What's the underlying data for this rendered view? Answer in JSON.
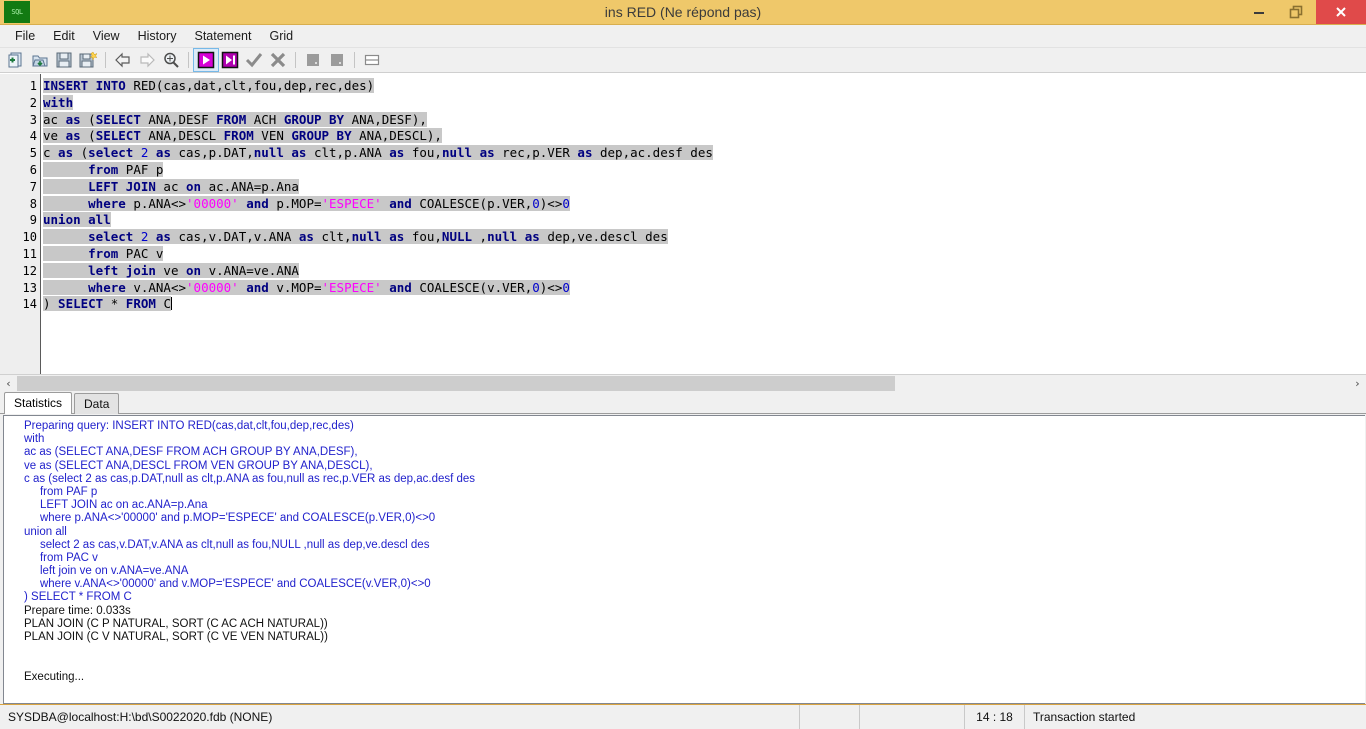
{
  "window": {
    "title": "ins RED (Ne répond pas)",
    "app_icon_text": "SQL",
    "controls": {
      "minimize": "minimize-button",
      "restore": "restore-button",
      "close": "close-button"
    }
  },
  "menubar": {
    "items": [
      {
        "label": "File"
      },
      {
        "label": "Edit"
      },
      {
        "label": "View"
      },
      {
        "label": "History"
      },
      {
        "label": "Statement"
      },
      {
        "label": "Grid"
      }
    ]
  },
  "toolbar": {
    "buttons": [
      {
        "name": "new-query-icon",
        "title": "New"
      },
      {
        "name": "open-file-icon",
        "title": "Open"
      },
      {
        "name": "save-icon",
        "title": "Save"
      },
      {
        "name": "save-as-icon",
        "title": "Save As"
      },
      {
        "name": "history-back-icon",
        "title": "Previous statement"
      },
      {
        "name": "history-forward-icon",
        "title": "Next statement"
      },
      {
        "name": "find-icon",
        "title": "Find"
      },
      {
        "name": "execute-icon",
        "title": "Execute"
      },
      {
        "name": "execute-script-icon",
        "title": "Execute script"
      },
      {
        "name": "commit-icon",
        "title": "Commit"
      },
      {
        "name": "rollback-icon",
        "title": "Rollback"
      },
      {
        "name": "stop-icon",
        "title": "Stop"
      },
      {
        "name": "stop2-icon",
        "title": "Stop all"
      },
      {
        "name": "split-view-icon",
        "title": "Toggle split"
      }
    ]
  },
  "editor": {
    "line_numbers": [
      "1",
      "2",
      "3",
      "4",
      "5",
      "6",
      "7",
      "8",
      "9",
      "10",
      "11",
      "12",
      "13",
      "14"
    ],
    "lines": [
      {
        "n": "1",
        "tokens": [
          {
            "t": "INSERT INTO",
            "c": "kw"
          },
          {
            "t": " RED(cas,dat,clt,fou,dep,rec,des)",
            "c": ""
          }
        ]
      },
      {
        "n": "2",
        "tokens": [
          {
            "t": "with",
            "c": "kw"
          }
        ]
      },
      {
        "n": "3",
        "tokens": [
          {
            "t": "ac",
            "c": ""
          },
          {
            "t": " as ",
            "c": "kw"
          },
          {
            "t": "(",
            "c": ""
          },
          {
            "t": "SELECT",
            "c": "kw"
          },
          {
            "t": " ANA,DESF ",
            "c": ""
          },
          {
            "t": "FROM",
            "c": "kw"
          },
          {
            "t": " ACH ",
            "c": ""
          },
          {
            "t": "GROUP BY",
            "c": "kw"
          },
          {
            "t": " ANA,DESF),",
            "c": ""
          }
        ]
      },
      {
        "n": "4",
        "tokens": [
          {
            "t": "ve",
            "c": ""
          },
          {
            "t": " as ",
            "c": "kw"
          },
          {
            "t": "(",
            "c": ""
          },
          {
            "t": "SELECT",
            "c": "kw"
          },
          {
            "t": " ANA,DESCL ",
            "c": ""
          },
          {
            "t": "FROM",
            "c": "kw"
          },
          {
            "t": " VEN ",
            "c": ""
          },
          {
            "t": "GROUP BY",
            "c": "kw"
          },
          {
            "t": " ANA,DESCL),",
            "c": ""
          }
        ]
      },
      {
        "n": "5",
        "tokens": [
          {
            "t": "c",
            "c": ""
          },
          {
            "t": " as ",
            "c": "kw"
          },
          {
            "t": "(",
            "c": ""
          },
          {
            "t": "select",
            "c": "kw"
          },
          {
            "t": " ",
            "c": ""
          },
          {
            "t": "2",
            "c": "num"
          },
          {
            "t": " as ",
            "c": "kw"
          },
          {
            "t": "cas,p.DAT,",
            "c": ""
          },
          {
            "t": "null",
            "c": "kw"
          },
          {
            "t": " as ",
            "c": "kw"
          },
          {
            "t": "clt,p.ANA",
            "c": ""
          },
          {
            "t": " as ",
            "c": "kw"
          },
          {
            "t": "fou,",
            "c": ""
          },
          {
            "t": "null",
            "c": "kw"
          },
          {
            "t": " as ",
            "c": "kw"
          },
          {
            "t": "rec,p.VER",
            "c": ""
          },
          {
            "t": " as ",
            "c": "kw"
          },
          {
            "t": "dep,ac.desf des",
            "c": ""
          }
        ]
      },
      {
        "n": "6",
        "tokens": [
          {
            "t": "      ",
            "c": ""
          },
          {
            "t": "from",
            "c": "kw"
          },
          {
            "t": " PAF p",
            "c": ""
          }
        ]
      },
      {
        "n": "7",
        "tokens": [
          {
            "t": "      ",
            "c": ""
          },
          {
            "t": "LEFT JOIN",
            "c": "kw"
          },
          {
            "t": " ac ",
            "c": ""
          },
          {
            "t": "on",
            "c": "kw"
          },
          {
            "t": " ac.ANA=p.Ana",
            "c": ""
          }
        ]
      },
      {
        "n": "8",
        "tokens": [
          {
            "t": "      ",
            "c": ""
          },
          {
            "t": "where",
            "c": "kw"
          },
          {
            "t": " p.ANA<>",
            "c": ""
          },
          {
            "t": "'00000'",
            "c": "str"
          },
          {
            "t": " ",
            "c": ""
          },
          {
            "t": "and",
            "c": "kw"
          },
          {
            "t": " p.MOP=",
            "c": ""
          },
          {
            "t": "'ESPECE'",
            "c": "str"
          },
          {
            "t": " ",
            "c": ""
          },
          {
            "t": "and",
            "c": "kw"
          },
          {
            "t": " COALESCE(p.VER,",
            "c": ""
          },
          {
            "t": "0",
            "c": "num"
          },
          {
            "t": ")<>",
            "c": ""
          },
          {
            "t": "0",
            "c": "num"
          }
        ]
      },
      {
        "n": "9",
        "tokens": [
          {
            "t": "union all",
            "c": "kw"
          }
        ]
      },
      {
        "n": "10",
        "tokens": [
          {
            "t": "      ",
            "c": ""
          },
          {
            "t": "select",
            "c": "kw"
          },
          {
            "t": " ",
            "c": ""
          },
          {
            "t": "2",
            "c": "num"
          },
          {
            "t": " as ",
            "c": "kw"
          },
          {
            "t": "cas,v.DAT,v.ANA",
            "c": ""
          },
          {
            "t": " as ",
            "c": "kw"
          },
          {
            "t": "clt,",
            "c": ""
          },
          {
            "t": "null",
            "c": "kw"
          },
          {
            "t": " as ",
            "c": "kw"
          },
          {
            "t": "fou,",
            "c": ""
          },
          {
            "t": "NULL",
            "c": "kw"
          },
          {
            "t": " ,",
            "c": ""
          },
          {
            "t": "null",
            "c": "kw"
          },
          {
            "t": " as ",
            "c": "kw"
          },
          {
            "t": "dep,ve.descl des",
            "c": ""
          }
        ]
      },
      {
        "n": "11",
        "tokens": [
          {
            "t": "      ",
            "c": ""
          },
          {
            "t": "from",
            "c": "kw"
          },
          {
            "t": " PAC v",
            "c": ""
          }
        ]
      },
      {
        "n": "12",
        "tokens": [
          {
            "t": "      ",
            "c": ""
          },
          {
            "t": "left join",
            "c": "kw"
          },
          {
            "t": " ve ",
            "c": ""
          },
          {
            "t": "on",
            "c": "kw"
          },
          {
            "t": " v.ANA=ve.ANA",
            "c": ""
          }
        ]
      },
      {
        "n": "13",
        "tokens": [
          {
            "t": "      ",
            "c": ""
          },
          {
            "t": "where",
            "c": "kw"
          },
          {
            "t": " v.ANA<>",
            "c": ""
          },
          {
            "t": "'00000'",
            "c": "str"
          },
          {
            "t": " ",
            "c": ""
          },
          {
            "t": "and",
            "c": "kw"
          },
          {
            "t": " v.MOP=",
            "c": ""
          },
          {
            "t": "'ESPECE'",
            "c": "str"
          },
          {
            "t": " ",
            "c": ""
          },
          {
            "t": "and",
            "c": "kw"
          },
          {
            "t": " COALESCE(v.VER,",
            "c": ""
          },
          {
            "t": "0",
            "c": "num"
          },
          {
            "t": ")<>",
            "c": ""
          },
          {
            "t": "0",
            "c": "num"
          }
        ]
      },
      {
        "n": "14",
        "tokens": [
          {
            "t": ")",
            "c": ""
          },
          {
            "t": " SELECT ",
            "c": "kw"
          },
          {
            "t": "*",
            "c": ""
          },
          {
            "t": " FROM ",
            "c": "kw"
          },
          {
            "t": "C",
            "c": ""
          }
        ]
      }
    ],
    "scrollbar": {
      "left_arrow": "‹",
      "right_arrow": "›"
    }
  },
  "tabs": [
    {
      "label": "Statistics",
      "active": true
    },
    {
      "label": "Data",
      "active": false
    }
  ],
  "output": {
    "lines": [
      {
        "text": "Preparing query: INSERT INTO RED(cas,dat,clt,fou,dep,rec,des)",
        "style": "blue"
      },
      {
        "text": "with",
        "style": "blue"
      },
      {
        "text": "ac as (SELECT ANA,DESF FROM ACH GROUP BY ANA,DESF),",
        "style": "blue"
      },
      {
        "text": "ve as (SELECT ANA,DESCL FROM VEN GROUP BY ANA,DESCL),",
        "style": "blue"
      },
      {
        "text": "c as (select 2 as cas,p.DAT,null as clt,p.ANA as fou,null as rec,p.VER as dep,ac.desf des",
        "style": "blue"
      },
      {
        "text": "     from PAF p",
        "style": "blue"
      },
      {
        "text": "     LEFT JOIN ac on ac.ANA=p.Ana",
        "style": "blue"
      },
      {
        "text": "     where p.ANA<>'00000' and p.MOP='ESPECE' and COALESCE(p.VER,0)<>0",
        "style": "blue"
      },
      {
        "text": "union all",
        "style": "blue"
      },
      {
        "text": "     select 2 as cas,v.DAT,v.ANA as clt,null as fou,NULL ,null as dep,ve.descl des",
        "style": "blue"
      },
      {
        "text": "     from PAC v",
        "style": "blue"
      },
      {
        "text": "     left join ve on v.ANA=ve.ANA",
        "style": "blue"
      },
      {
        "text": "     where v.ANA<>'00000' and v.MOP='ESPECE' and COALESCE(v.VER,0)<>0",
        "style": "blue"
      },
      {
        "text": ") SELECT * FROM C",
        "style": "blue"
      },
      {
        "text": "Prepare time: 0.033s",
        "style": "dark"
      },
      {
        "text": "PLAN JOIN (C P NATURAL, SORT (C AC ACH NATURAL))",
        "style": "dark"
      },
      {
        "text": "PLAN JOIN (C V NATURAL, SORT (C VE VEN NATURAL))",
        "style": "dark"
      },
      {
        "text": "",
        "style": "blank"
      },
      {
        "text": "",
        "style": "blank"
      },
      {
        "text": "Executing...",
        "style": "dark"
      }
    ]
  },
  "statusbar": {
    "connection": "SYSDBA@localhost:H:\\bd\\S0022020.fdb (NONE)",
    "field2": "",
    "field3": "",
    "position": "14 : 18",
    "transaction": "Transaction started"
  },
  "colors": {
    "titlebar": "#efc86a",
    "close_button": "#e04a4a",
    "keyword": "#000080",
    "string": "#ff00ff",
    "number": "#0000cc",
    "selection": "#c8c8c8",
    "output_text": "#2222cc"
  }
}
